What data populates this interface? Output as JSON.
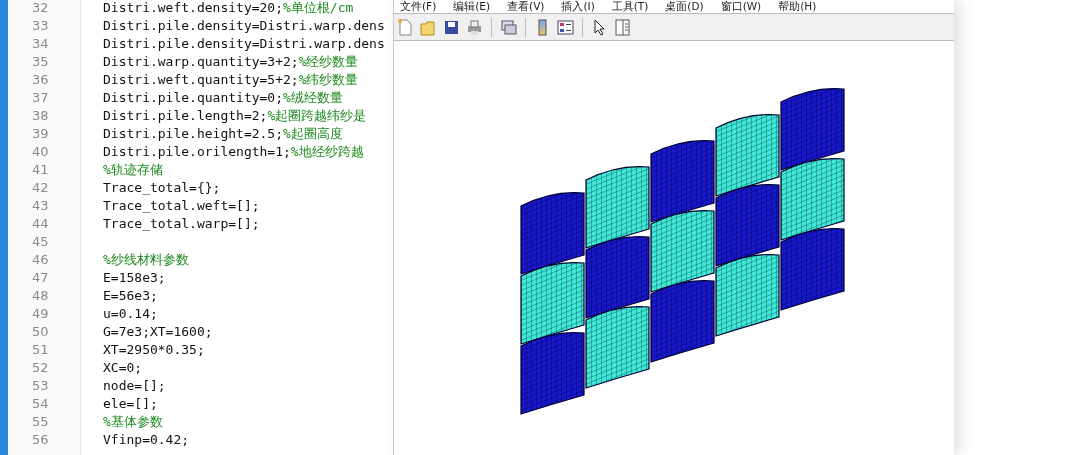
{
  "editor": {
    "lines": [
      {
        "number": "32",
        "code": "Distri.weft.density=20;",
        "comment": "%单位根/cm"
      },
      {
        "number": "33",
        "code": "Distri.pile.density=Distri.warp.dens"
      },
      {
        "number": "34",
        "code": "Distri.pile.density=Distri.warp.dens"
      },
      {
        "number": "35",
        "code": "Distri.warp.quantity=3+2;",
        "comment": "%经纱数量"
      },
      {
        "number": "36",
        "code": "Distri.weft.quantity=5+2;",
        "comment": "%纬纱数量"
      },
      {
        "number": "37",
        "code": "Distri.pile.quantity=0;",
        "comment": "%绒经数量"
      },
      {
        "number": "38",
        "code": "Distri.pile.length=2;",
        "comment": "%起圈跨越纬纱是"
      },
      {
        "number": "39",
        "code": "Distri.pile.height=2.5;",
        "comment": "%起圈高度"
      },
      {
        "number": "40",
        "code": "Distri.pile.orilength=1;",
        "comment": "%地经纱跨越"
      },
      {
        "number": "41",
        "comment": "%轨迹存储"
      },
      {
        "number": "42",
        "code": "Trace_total={};"
      },
      {
        "number": "43",
        "code": "Trace_total.weft=[];"
      },
      {
        "number": "44",
        "code": "Trace_total.warp=[];"
      },
      {
        "number": "45"
      },
      {
        "number": "46",
        "comment": "%纱线材料参数"
      },
      {
        "number": "47",
        "code": "E=158e3;"
      },
      {
        "number": "48",
        "code": "E=56e3;"
      },
      {
        "number": "49",
        "code": "u=0.14;"
      },
      {
        "number": "50",
        "code": "G=7e3;XT=1600;"
      },
      {
        "number": "51",
        "code": "XT=2950*0.35;"
      },
      {
        "number": "52",
        "code": "XC=0;"
      },
      {
        "number": "53",
        "code": "node=[];"
      },
      {
        "number": "54",
        "code": "ele=[];"
      },
      {
        "number": "55",
        "comment": "%基体参数"
      },
      {
        "number": "56",
        "code": "Vfinp=0.42;"
      }
    ]
  },
  "figure": {
    "menu": [
      "文件(F)",
      "编辑(E)",
      "查看(V)",
      "插入(I)",
      "工具(T)",
      "桌面(D)",
      "窗口(W)",
      "帮助(H)"
    ]
  }
}
